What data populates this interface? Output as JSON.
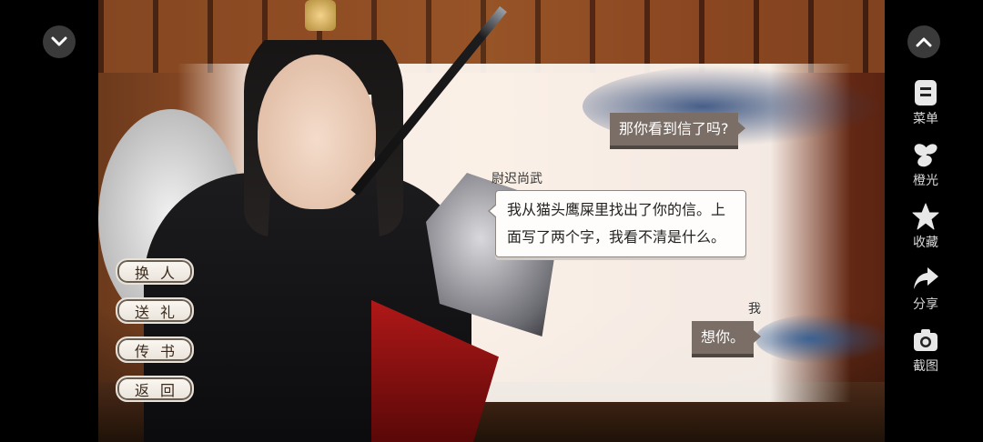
{
  "left_menu": {
    "items": [
      {
        "label": "换人"
      },
      {
        "label": "送礼"
      },
      {
        "label": "传书"
      },
      {
        "label": "返回"
      }
    ]
  },
  "dialogue": {
    "me_1": "那你看到信了吗?",
    "npc_name": "尉迟尚武",
    "npc_line": "我从猫头鹰屎里找出了你的信。上面写了两个字，我看不清是什么。",
    "me_name": "我",
    "me_2": "想你。"
  },
  "right_menu": {
    "items": [
      {
        "label": "菜单",
        "icon": "menu-icon"
      },
      {
        "label": "橙光",
        "icon": "orange-light-icon"
      },
      {
        "label": "收藏",
        "icon": "star-icon"
      },
      {
        "label": "分享",
        "icon": "share-icon"
      },
      {
        "label": "截图",
        "icon": "camera-icon"
      }
    ]
  }
}
